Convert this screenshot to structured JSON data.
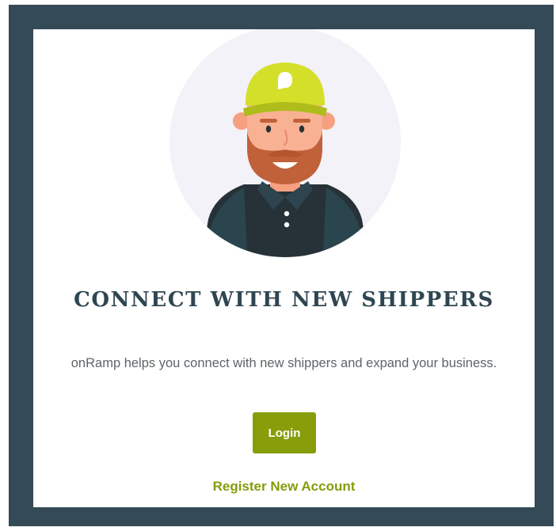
{
  "hero": {
    "illustration_icon": "delivery-driver-avatar-icon",
    "headline": "CONNECT WITH NEW SHIPPERS",
    "description": "onRamp helps you connect with new shippers and expand your business."
  },
  "actions": {
    "login_label": "Login",
    "register_label": "Register New Account"
  },
  "colors": {
    "frame": "#344a56",
    "card": "#ffffff",
    "headline": "#2f4652",
    "accent": "#879d0a",
    "body_text": "#5e6468"
  }
}
